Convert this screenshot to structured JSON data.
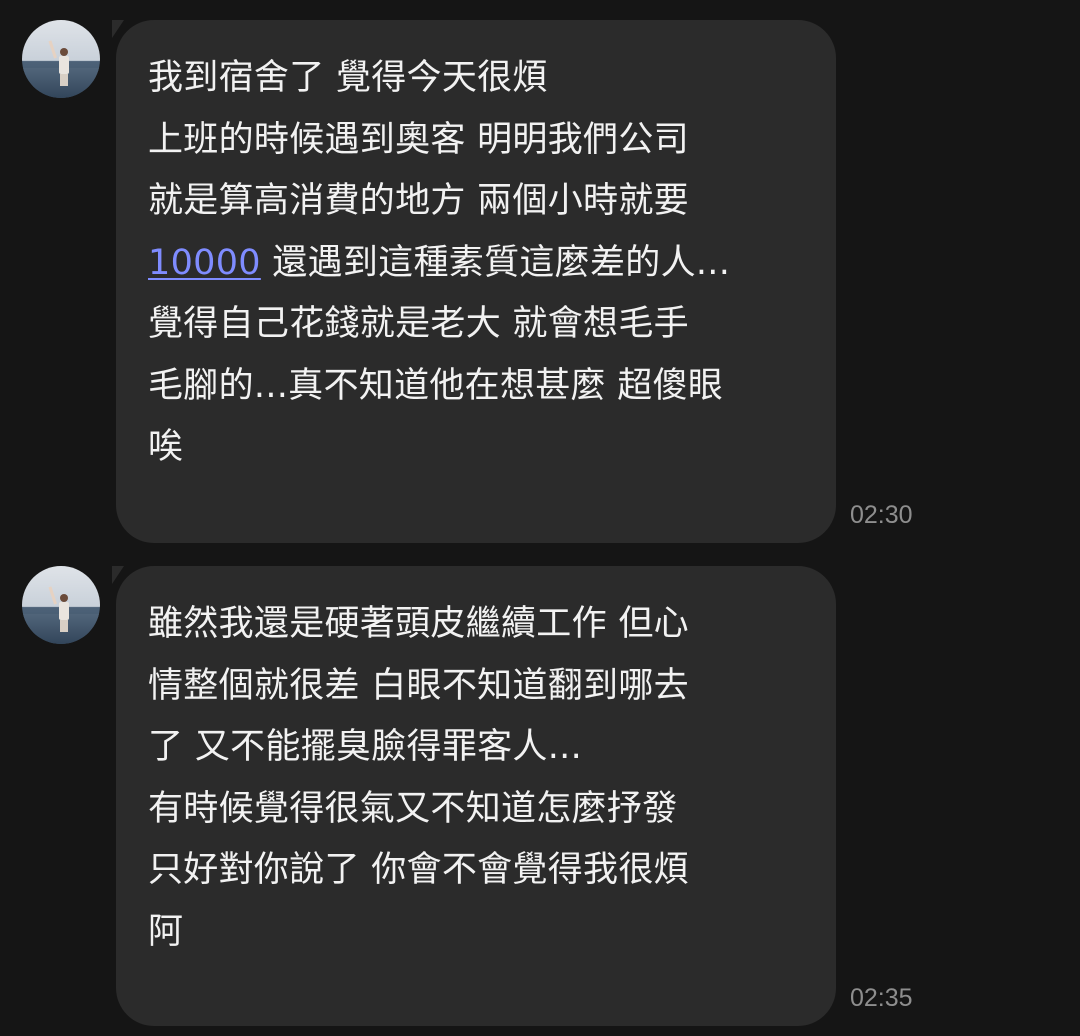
{
  "messages": [
    {
      "lines": [
        "我到宿舍了 覺得今天很煩",
        "上班的時候遇到奧客 明明我們公司",
        "就是算高消費的地方 兩個小時就要",
        "還遇到這種素質這麼差的人...",
        "覺得自己花錢就是老大 就會想毛手",
        "毛腳的...真不知道他在想甚麼 超傻眼",
        "唉"
      ],
      "link_text": "10000",
      "time": "02:30"
    },
    {
      "lines": [
        "雖然我還是硬著頭皮繼續工作 但心",
        "情整個就很差 白眼不知道翻到哪去",
        "了 又不能擺臭臉得罪客人...",
        "有時候覺得很氣又不知道怎麼抒發",
        "只好對你說了 你會不會覺得我很煩",
        "阿"
      ],
      "time": "02:35"
    }
  ],
  "colors": {
    "background": "#151515",
    "bubble": "#2b2b2b",
    "text": "#f2f2f2",
    "link": "#7f8cff",
    "timestamp": "#8e8e8e"
  }
}
